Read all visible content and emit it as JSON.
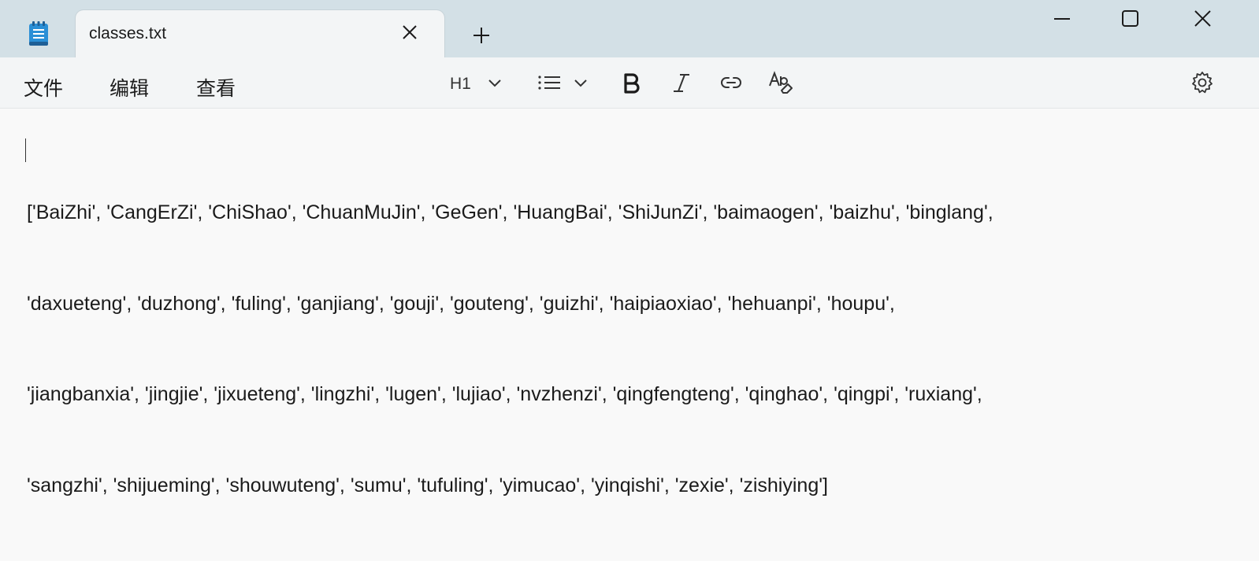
{
  "app": {
    "icon": "notepad-icon"
  },
  "tab": {
    "title": "classes.txt",
    "close_icon": "close-icon"
  },
  "new_tab_icon": "plus-icon",
  "window_controls": {
    "minimize_icon": "minimize-icon",
    "maximize_icon": "maximize-icon",
    "close_icon": "close-icon"
  },
  "menu": {
    "file": "文件",
    "edit": "编辑",
    "view": "查看"
  },
  "toolbar": {
    "heading": "H1",
    "heading_icon": "chevron-down-icon",
    "list_icon": "bulleted-list-icon",
    "bold_icon": "bold-icon",
    "italic_icon": "italic-icon",
    "link_icon": "link-icon",
    "clear_format_icon": "clear-formatting-icon",
    "settings_icon": "gear-icon"
  },
  "document": {
    "lines": [
      "['BaiZhi', 'CangErZi', 'ChiShao', 'ChuanMuJin', 'GeGen', 'HuangBai', 'ShiJunZi', 'baimaogen', 'baizhu', 'binglang',",
      "'daxueteng', 'duzhong', 'fuling', 'ganjiang', 'gouji', 'gouteng', 'guizhi', 'haipiaoxiao', 'hehuanpi', 'houpu',",
      "'jiangbanxia', 'jingjie', 'jixueteng', 'lingzhi', 'lugen', 'lujiao', 'nvzhenzi', 'qingfengteng', 'qinghao', 'qingpi', 'ruxiang',",
      "'sangzhi', 'shijueming', 'shouwuteng', 'sumu', 'tufuling', 'yimucao', 'yinqishi', 'zexie', 'zishiying']"
    ]
  }
}
